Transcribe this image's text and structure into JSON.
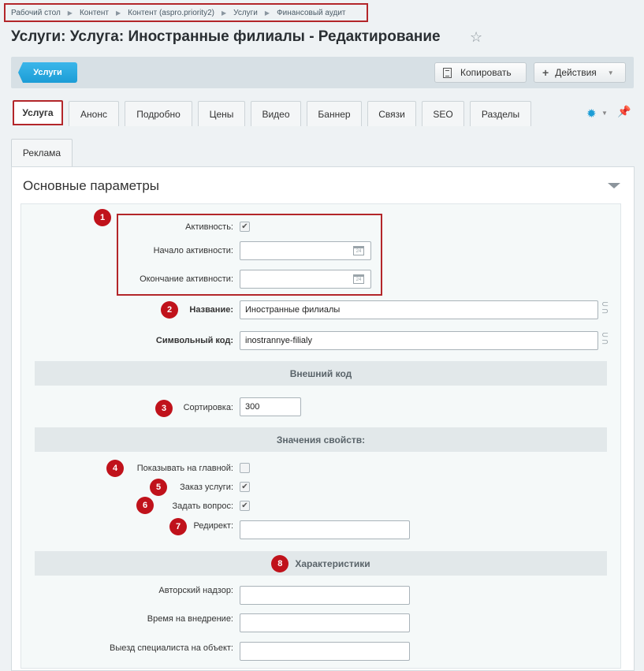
{
  "breadcrumb": [
    "Рабочий стол",
    "Контент",
    "Контент (aspro.priority2)",
    "Услуги",
    "Финансовый аудит"
  ],
  "page_title": "Услуги: Услуга: Иностранные филиалы - Редактирование",
  "toolbar": {
    "back_label": "Услуги",
    "copy_label": "Копировать",
    "actions_label": "Действия"
  },
  "tabs": [
    "Услуга",
    "Анонс",
    "Подробно",
    "Цены",
    "Видео",
    "Баннер",
    "Связи",
    "SEO",
    "Разделы",
    "Реклама"
  ],
  "section_title": "Основные параметры",
  "fields": {
    "active_label": "Активность:",
    "active_from_label": "Начало активности:",
    "active_to_label": "Окончание активности:",
    "name_label": "Название:",
    "name_value": "Иностранные филиалы",
    "code_label": "Символьный код:",
    "code_value": "inostrannye-filialy",
    "external_code_group": "Внешний код",
    "sort_label": "Сортировка:",
    "sort_value": "300",
    "properties_group": "Значения свойств:",
    "show_main_label": "Показывать на главной:",
    "order_label": "Заказ услуги:",
    "ask_label": "Задать вопрос:",
    "redirect_label": "Редирект:",
    "characteristics_group": "Характеристики",
    "supervision_label": "Авторский надзор:",
    "implementation_label": "Время на внедрение:",
    "visit_label": "Выезд специалиста на объект:"
  },
  "calendar_day": "24",
  "badges": [
    "1",
    "2",
    "3",
    "4",
    "5",
    "6",
    "7",
    "8"
  ],
  "colors": {
    "accent": "#1c9dd6",
    "highlight": "#b3262a",
    "badge": "#c0121b"
  }
}
